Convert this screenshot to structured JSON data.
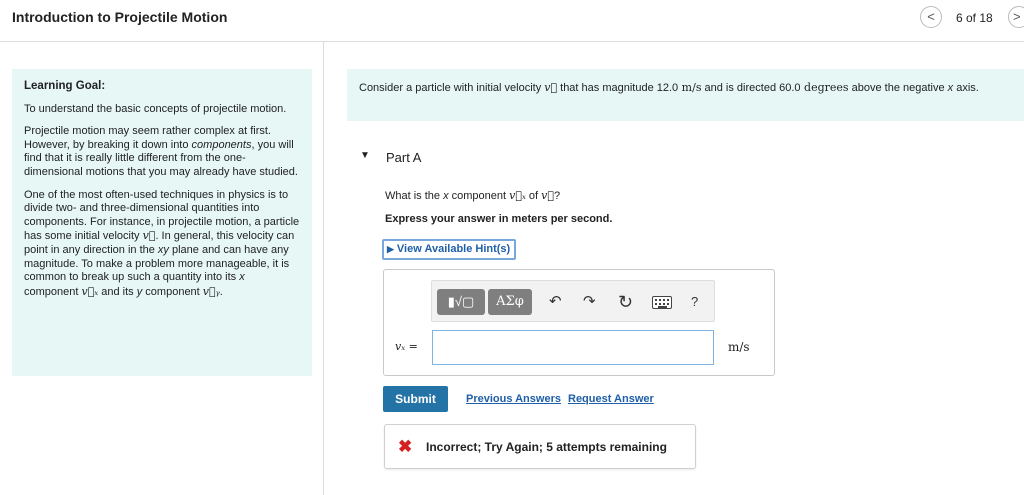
{
  "header": {
    "title": "Introduction to Projectile Motion",
    "prev_icon": "chevron-left-icon",
    "next_icon": "chevron-right-icon",
    "prev_symbol": "<",
    "next_symbol": ">",
    "page_count": "6 of 18"
  },
  "goal": {
    "title": "Learning Goal:",
    "p1": "To understand the basic concepts of projectile motion.",
    "p2_a": "Projectile motion may seem rather complex at first. However, by breaking it down into ",
    "p2_em": "components",
    "p2_b": ", you will find that it is really little different from the one-dimensional motions that you may already have studied.",
    "p3_a": "One of the most often-used techniques in physics is to divide two- and three-dimensional quantities into components. For instance, in projectile motion, a particle has some initial velocity ",
    "p3_v": "v⃗",
    "p3_b": ". In general, this velocity can point in any direction in the ",
    "p3_xy": "xy",
    "p3_c": " plane and can have any magnitude. To make a problem more manageable, it is common to break up such a quantity into its ",
    "p3_x": "x",
    "p3_d": " component ",
    "p3_vx": "v⃗ₓ",
    "p3_e": " and its ",
    "p3_y": "y",
    "p3_f": " component ",
    "p3_vy": "v⃗ᵧ",
    "p3_g": "."
  },
  "intro": {
    "a": "Consider a particle with initial velocity ",
    "v": "v⃗",
    "b": " that has magnitude ",
    "mag": "12.0",
    "unit": " m/s",
    "c": " and is directed ",
    "angle": "60.0",
    "deg": " degrees",
    "d": " above the negative ",
    "x": "x",
    "e": " axis."
  },
  "part": {
    "toggle_icon": "triangle-down-icon",
    "toggle_symbol": "▼",
    "label": "Part A",
    "question_a": "What is the ",
    "question_x": "x",
    "question_b": " component ",
    "question_vx": "v⃗ₓ",
    "question_c": " of ",
    "question_v": "v⃗",
    "question_d": "?",
    "express": "Express your answer in meters per second.",
    "hints_icon": "triangle-right-icon",
    "hints_symbol": "▶",
    "hints_label": "View Available Hint(s)"
  },
  "answer": {
    "toolbar": {
      "templates_label": "▮√▢",
      "symbols_label": "ΑΣφ",
      "undo_icon": "undo-icon",
      "undo_symbol": "↶",
      "redo_icon": "redo-icon",
      "redo_symbol": "↷",
      "reset_icon": "reset-icon",
      "reset_symbol": "↻",
      "keyboard_icon": "keyboard-icon",
      "help_icon": "help-icon",
      "help_symbol": "?"
    },
    "variable_label": "vₓ =",
    "input_value": "",
    "unit": "m/s"
  },
  "actions": {
    "submit_label": "Submit",
    "previous_answers_label": "Previous Answers",
    "request_answer_label": "Request Answer"
  },
  "feedback": {
    "icon": "x-icon",
    "icon_symbol": "✖",
    "message": "Incorrect; Try Again; 5 attempts remaining"
  },
  "colors": {
    "panel_bg": "#e6f7f6",
    "link": "#1e5fa8",
    "submit_bg": "#2473a6",
    "error": "#d42020"
  }
}
